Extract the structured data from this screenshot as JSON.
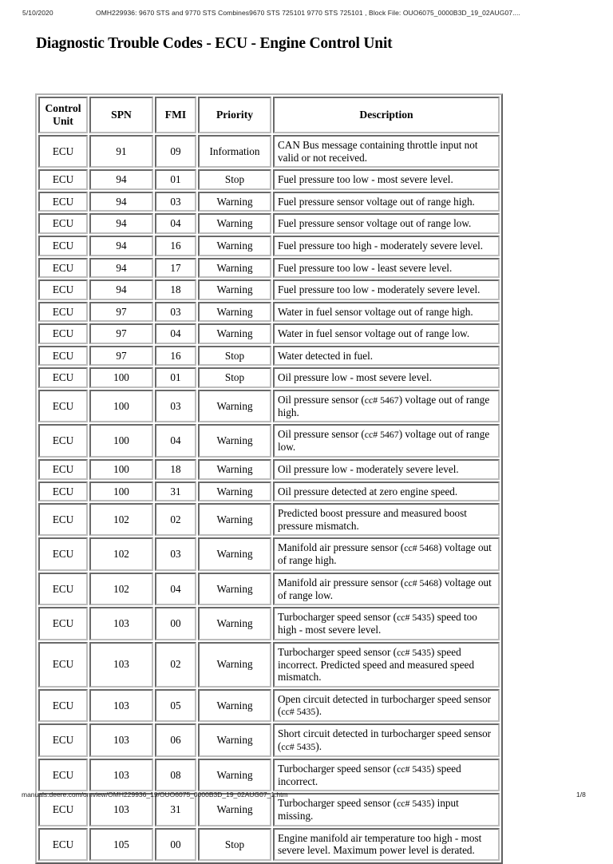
{
  "print_header": {
    "date": "5/10/2020",
    "document_title": "OMH229936: 9670 STS and 9770 STS Combines9670 STS 725101 9770 STS 725101 , Block File: OUO6075_0000B3D_19_02AUG07...."
  },
  "page_title": "Diagnostic Trouble Codes - ECU - Engine Control Unit",
  "table": {
    "columns": [
      "Control Unit",
      "SPN",
      "FMI",
      "Priority",
      "Description"
    ],
    "rows": [
      {
        "unit": "ECU",
        "spn": "91",
        "fmi": "09",
        "priority": "Information",
        "description": "CAN Bus message containing throttle input not valid or not received."
      },
      {
        "unit": "ECU",
        "spn": "94",
        "fmi": "01",
        "priority": "Stop",
        "description": "Fuel pressure too low - most severe level."
      },
      {
        "unit": "ECU",
        "spn": "94",
        "fmi": "03",
        "priority": "Warning",
        "description": "Fuel pressure sensor voltage out of range high."
      },
      {
        "unit": "ECU",
        "spn": "94",
        "fmi": "04",
        "priority": "Warning",
        "description": "Fuel pressure sensor voltage out of range low."
      },
      {
        "unit": "ECU",
        "spn": "94",
        "fmi": "16",
        "priority": "Warning",
        "description": "Fuel pressure too high - moderately severe level."
      },
      {
        "unit": "ECU",
        "spn": "94",
        "fmi": "17",
        "priority": "Warning",
        "description": "Fuel pressure too low - least severe level."
      },
      {
        "unit": "ECU",
        "spn": "94",
        "fmi": "18",
        "priority": "Warning",
        "description": "Fuel pressure too low - moderately severe level."
      },
      {
        "unit": "ECU",
        "spn": "97",
        "fmi": "03",
        "priority": "Warning",
        "description": "Water in fuel sensor voltage out of range high."
      },
      {
        "unit": "ECU",
        "spn": "97",
        "fmi": "04",
        "priority": "Warning",
        "description": "Water in fuel sensor voltage out of range low."
      },
      {
        "unit": "ECU",
        "spn": "97",
        "fmi": "16",
        "priority": "Stop",
        "description": "Water detected in fuel."
      },
      {
        "unit": "ECU",
        "spn": "100",
        "fmi": "01",
        "priority": "Stop",
        "description": "Oil pressure low - most severe level."
      },
      {
        "unit": "ECU",
        "spn": "100",
        "fmi": "03",
        "priority": "Warning",
        "description": "Oil pressure sensor (cc# 5467) voltage out of range high."
      },
      {
        "unit": "ECU",
        "spn": "100",
        "fmi": "04",
        "priority": "Warning",
        "description": "Oil pressure sensor (cc# 5467) voltage out of range low."
      },
      {
        "unit": "ECU",
        "spn": "100",
        "fmi": "18",
        "priority": "Warning",
        "description": "Oil pressure low - moderately severe level."
      },
      {
        "unit": "ECU",
        "spn": "100",
        "fmi": "31",
        "priority": "Warning",
        "description": "Oil pressure detected at zero engine speed."
      },
      {
        "unit": "ECU",
        "spn": "102",
        "fmi": "02",
        "priority": "Warning",
        "description": "Predicted boost pressure and measured boost pressure mismatch."
      },
      {
        "unit": "ECU",
        "spn": "102",
        "fmi": "03",
        "priority": "Warning",
        "description": "Manifold air pressure sensor (cc# 5468) voltage out of range high."
      },
      {
        "unit": "ECU",
        "spn": "102",
        "fmi": "04",
        "priority": "Warning",
        "description": "Manifold air pressure sensor (cc# 5468) voltage out of range low."
      },
      {
        "unit": "ECU",
        "spn": "103",
        "fmi": "00",
        "priority": "Warning",
        "description": "Turbocharger speed sensor (cc# 5435) speed too high - most severe level."
      },
      {
        "unit": "ECU",
        "spn": "103",
        "fmi": "02",
        "priority": "Warning",
        "description": "Turbocharger speed sensor (cc# 5435) speed incorrect. Predicted speed and measured speed mismatch."
      },
      {
        "unit": "ECU",
        "spn": "103",
        "fmi": "05",
        "priority": "Warning",
        "description": "Open circuit detected in turbocharger speed sensor (cc# 5435)."
      },
      {
        "unit": "ECU",
        "spn": "103",
        "fmi": "06",
        "priority": "Warning",
        "description": "Short circuit detected in turbocharger speed sensor (cc# 5435)."
      },
      {
        "unit": "ECU",
        "spn": "103",
        "fmi": "08",
        "priority": "Warning",
        "description": "Turbocharger speed sensor (cc# 5435) speed incorrect."
      },
      {
        "unit": "ECU",
        "spn": "103",
        "fmi": "31",
        "priority": "Warning",
        "description": "Turbocharger speed sensor (cc# 5435) input missing."
      },
      {
        "unit": "ECU",
        "spn": "105",
        "fmi": "00",
        "priority": "Stop",
        "description": "Engine manifold air temperature too high - most severe level. Maximum power level is derated."
      }
    ]
  },
  "print_footer": {
    "url": "manuals.deere.com/omview/OMH229936_19/OUO6075_0000B3D_19_02AUG07_1.htm",
    "page_number": "1/8"
  }
}
